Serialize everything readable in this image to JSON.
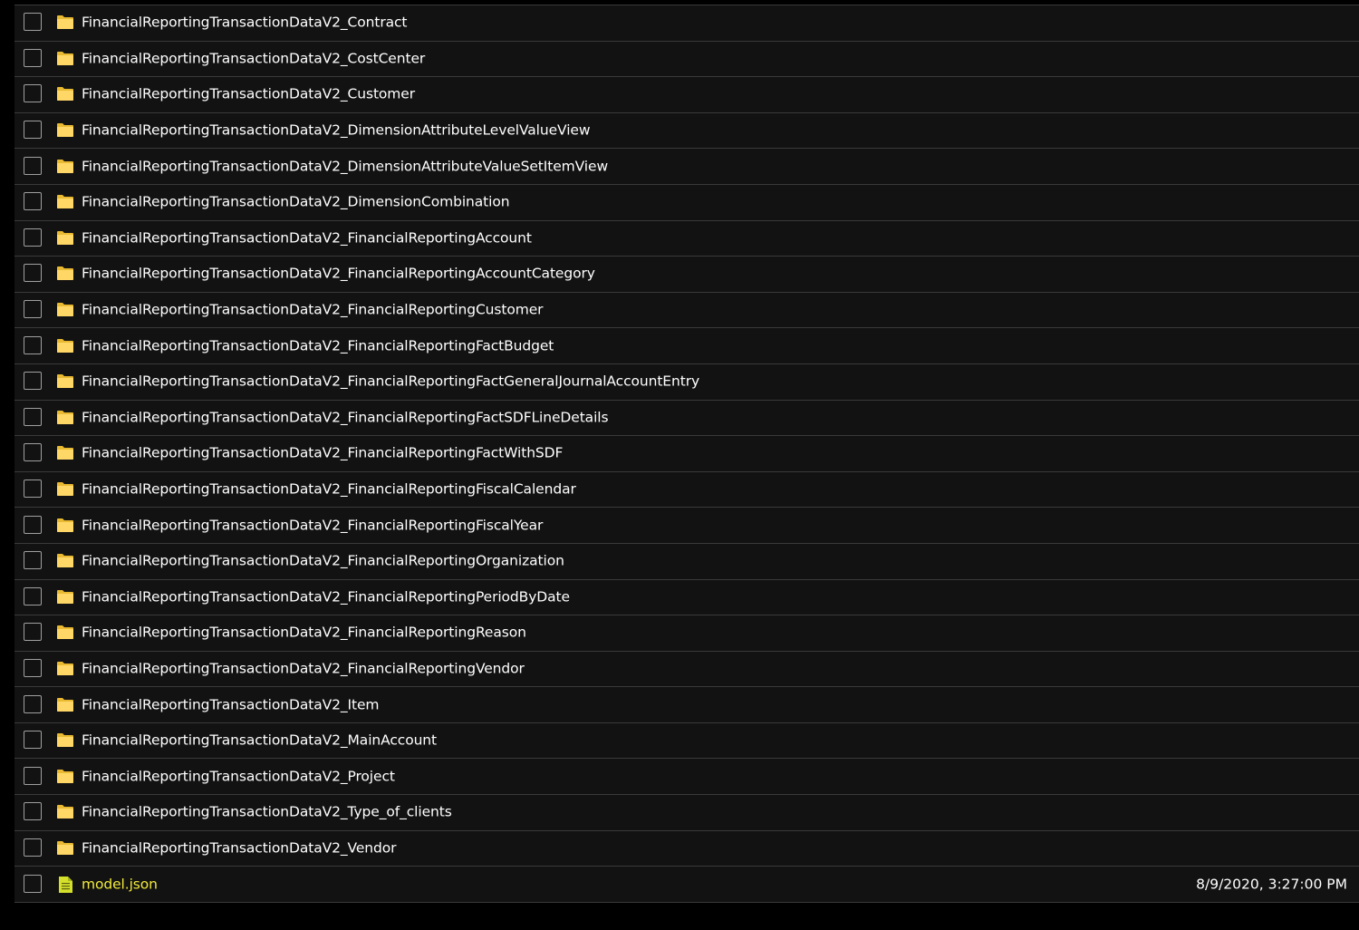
{
  "colors": {
    "background": "#000000",
    "row_background": "#121212",
    "divider": "#3a3a3a",
    "folder": "#ffd766",
    "file_name": "#f2ea3c",
    "json_file_icon": "#d4e02b"
  },
  "items": [
    {
      "name": "FinancialReportingTransactionDataV2_Contract",
      "type": "folder",
      "icon": "folder-icon",
      "modified": ""
    },
    {
      "name": "FinancialReportingTransactionDataV2_CostCenter",
      "type": "folder",
      "icon": "folder-icon",
      "modified": ""
    },
    {
      "name": "FinancialReportingTransactionDataV2_Customer",
      "type": "folder",
      "icon": "folder-icon",
      "modified": ""
    },
    {
      "name": "FinancialReportingTransactionDataV2_DimensionAttributeLevelValueView",
      "type": "folder",
      "icon": "folder-icon",
      "modified": ""
    },
    {
      "name": "FinancialReportingTransactionDataV2_DimensionAttributeValueSetItemView",
      "type": "folder",
      "icon": "folder-icon",
      "modified": ""
    },
    {
      "name": "FinancialReportingTransactionDataV2_DimensionCombination",
      "type": "folder",
      "icon": "folder-icon",
      "modified": ""
    },
    {
      "name": "FinancialReportingTransactionDataV2_FinancialReportingAccount",
      "type": "folder",
      "icon": "folder-icon",
      "modified": ""
    },
    {
      "name": "FinancialReportingTransactionDataV2_FinancialReportingAccountCategory",
      "type": "folder",
      "icon": "folder-icon",
      "modified": ""
    },
    {
      "name": "FinancialReportingTransactionDataV2_FinancialReportingCustomer",
      "type": "folder",
      "icon": "folder-icon",
      "modified": ""
    },
    {
      "name": "FinancialReportingTransactionDataV2_FinancialReportingFactBudget",
      "type": "folder",
      "icon": "folder-icon",
      "modified": ""
    },
    {
      "name": "FinancialReportingTransactionDataV2_FinancialReportingFactGeneralJournalAccountEntry",
      "type": "folder",
      "icon": "folder-icon",
      "modified": ""
    },
    {
      "name": "FinancialReportingTransactionDataV2_FinancialReportingFactSDFLineDetails",
      "type": "folder",
      "icon": "folder-icon",
      "modified": ""
    },
    {
      "name": "FinancialReportingTransactionDataV2_FinancialReportingFactWithSDF",
      "type": "folder",
      "icon": "folder-icon",
      "modified": ""
    },
    {
      "name": "FinancialReportingTransactionDataV2_FinancialReportingFiscalCalendar",
      "type": "folder",
      "icon": "folder-icon",
      "modified": ""
    },
    {
      "name": "FinancialReportingTransactionDataV2_FinancialReportingFiscalYear",
      "type": "folder",
      "icon": "folder-icon",
      "modified": ""
    },
    {
      "name": "FinancialReportingTransactionDataV2_FinancialReportingOrganization",
      "type": "folder",
      "icon": "folder-icon",
      "modified": ""
    },
    {
      "name": "FinancialReportingTransactionDataV2_FinancialReportingPeriodByDate",
      "type": "folder",
      "icon": "folder-icon",
      "modified": ""
    },
    {
      "name": "FinancialReportingTransactionDataV2_FinancialReportingReason",
      "type": "folder",
      "icon": "folder-icon",
      "modified": ""
    },
    {
      "name": "FinancialReportingTransactionDataV2_FinancialReportingVendor",
      "type": "folder",
      "icon": "folder-icon",
      "modified": ""
    },
    {
      "name": "FinancialReportingTransactionDataV2_Item",
      "type": "folder",
      "icon": "folder-icon",
      "modified": ""
    },
    {
      "name": "FinancialReportingTransactionDataV2_MainAccount",
      "type": "folder",
      "icon": "folder-icon",
      "modified": ""
    },
    {
      "name": "FinancialReportingTransactionDataV2_Project",
      "type": "folder",
      "icon": "folder-icon",
      "modified": ""
    },
    {
      "name": "FinancialReportingTransactionDataV2_Type_of_clients",
      "type": "folder",
      "icon": "folder-icon",
      "modified": ""
    },
    {
      "name": "FinancialReportingTransactionDataV2_Vendor",
      "type": "folder",
      "icon": "folder-icon",
      "modified": ""
    },
    {
      "name": "model.json",
      "type": "file",
      "icon": "json-file-icon",
      "modified": "8/9/2020, 3:27:00 PM"
    }
  ]
}
